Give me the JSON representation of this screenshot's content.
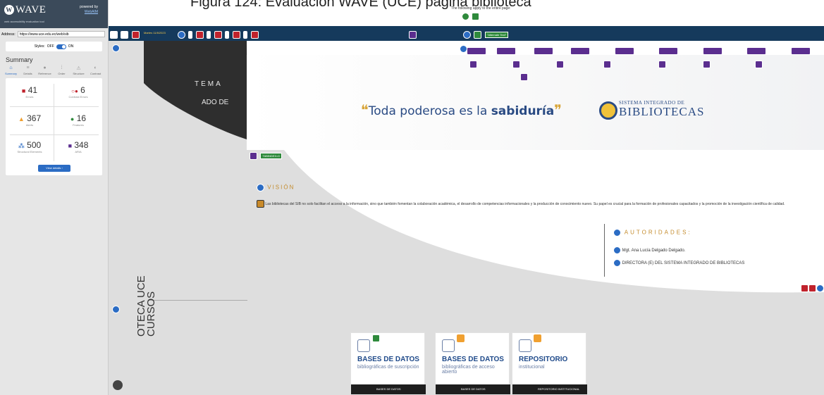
{
  "caption": "Figura 124: Evaluación WAVE (UCE) página biblioteca",
  "apply_note": "The following apply to the entire page:",
  "sidebar": {
    "brand": "WAVE",
    "tagline": "web accessibility evaluation tool",
    "powered_by": "powered by",
    "powered_link": "WebAIM",
    "address_label": "Address:",
    "address_value": "https://www.uce.edu.ec/web/sib",
    "styles_label": "Styles:",
    "styles_off": "OFF",
    "styles_on": "ON",
    "summary_title": "Summary",
    "tabs": [
      {
        "label": "Summary",
        "icon": "home-icon"
      },
      {
        "label": "Details",
        "icon": "list-icon"
      },
      {
        "label": "Reference",
        "icon": "info-icon"
      },
      {
        "label": "Order",
        "icon": "order-icon"
      },
      {
        "label": "Structure",
        "icon": "structure-icon"
      },
      {
        "label": "Contrast",
        "icon": "contrast-icon"
      }
    ],
    "stats": {
      "errors": {
        "count": "41",
        "label": "Errors"
      },
      "contrast": {
        "count": "6",
        "label": "Contrast Errors"
      },
      "alerts": {
        "count": "367",
        "label": "Alerts"
      },
      "features": {
        "count": "16",
        "label": "Features"
      },
      "structural": {
        "count": "500",
        "label": "Structural Elements"
      },
      "aria": {
        "count": "348",
        "label": "ARIA"
      }
    },
    "view_details": "View details ›"
  },
  "toolbar": {
    "date_label": "Martes 11/6/2023",
    "alt_text_tag": "\"Alternate Text\""
  },
  "main": {
    "wedge_text_1": "TEMA",
    "wedge_text_2": "ADO DE",
    "quote_pre": "Toda poderosa es la",
    "quote_bold": "sabiduría",
    "sib_small": "SISTEMA INTEGRADO DE",
    "sib_big": "BIBLIOTECAS",
    "tabindex_tag": "TABINDEX=0",
    "vision_heading": "VISIÓN",
    "vision_text": "Las bibliotecas del SIB no solo facilitan el acceso a la información, sino que también fomentan la colaboración académica, el desarrollo de competencias informacionales y la producción de conocimiento nuevo. Su papel es crucial para la formación de profesionales capacitados y la promoción de la investigación científica de calidad.",
    "auth_heading": "AUTORIDADES:",
    "auth_name": "Mgt. Ana Lucía Delgado Delgado.",
    "auth_role": "DIRECTORA (E) DEL SISTEMA INTEGRADO DE BIBLIOTECAS",
    "vertical_text_1": "OTECA UCE",
    "vertical_text_2": "CURSOS",
    "cards": [
      {
        "title": "BASES DE DATOS",
        "subtitle": "bibliográficas de suscripción",
        "bar": "BASES DE DATOS"
      },
      {
        "title": "BASES DE DATOS",
        "subtitle": "bibliográficas de acceso abierto",
        "bar": "BASES DE DATOS"
      },
      {
        "title": "REPOSITORIO",
        "subtitle": "institucional",
        "bar": "REPOSITORIO INSTITUCIONAL"
      }
    ]
  },
  "colors": {
    "toolbar_bg": "#153a5c",
    "error": "#c0222c",
    "aria": "#5b2e8f",
    "structure": "#2b6cc4",
    "feature": "#2f8a3c",
    "alert": "#f0a030"
  }
}
